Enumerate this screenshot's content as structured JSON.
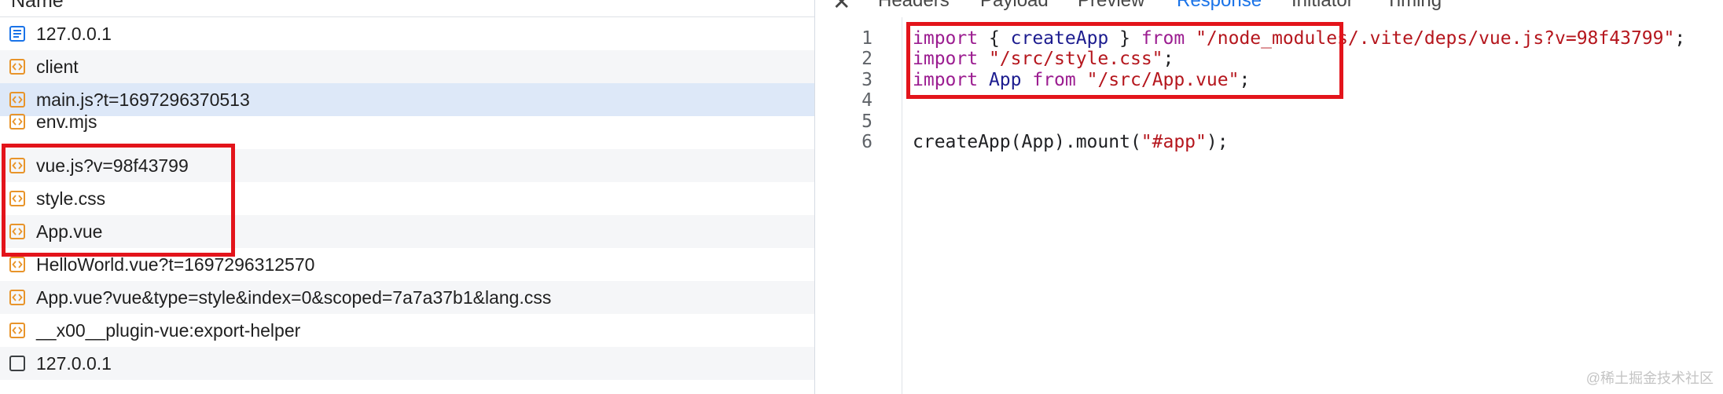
{
  "requests": {
    "header": "Name",
    "items": [
      {
        "label": "127.0.0.1",
        "icon": "document-icon"
      },
      {
        "label": "client",
        "icon": "script-icon"
      },
      {
        "label": "main.js?t=1697296370513",
        "icon": "script-icon"
      },
      {
        "label": "env.mjs",
        "icon": "script-icon"
      },
      {
        "label": "vue.js?v=98f43799",
        "icon": "script-icon"
      },
      {
        "label": "style.css",
        "icon": "script-icon"
      },
      {
        "label": "App.vue",
        "icon": "script-icon"
      },
      {
        "label": "HelloWorld.vue?t=1697296312570",
        "icon": "script-icon"
      },
      {
        "label": "App.vue?vue&type=style&index=0&scoped=7a7a37b1&lang.css",
        "icon": "script-icon"
      },
      {
        "label": "__x00__plugin-vue:export-helper",
        "icon": "script-icon"
      },
      {
        "label": "127.0.0.1",
        "icon": "empty-checkbox-icon"
      }
    ]
  },
  "tabs": {
    "close": "✕",
    "headers": "Headers",
    "payload": "Payload",
    "preview": "Preview",
    "response": "Response",
    "initiator": "Initiator",
    "timing": "Timing"
  },
  "response": {
    "line_numbers": [
      "1",
      "2",
      "3",
      "4",
      "5",
      "6"
    ],
    "line1": {
      "kw1": "import",
      "p1": " { ",
      "id": "createApp",
      "p2": " } ",
      "kw2": "from",
      "sp": " ",
      "str": "\"/node_modules/.vite/deps/vue.js?v=98f43799\"",
      "end": ";"
    },
    "line2": {
      "kw": "import",
      "sp": " ",
      "str": "\"/src/style.css\"",
      "end": ";"
    },
    "line3": {
      "kw1": "import",
      "sp1": " ",
      "id": "App",
      "sp2": " ",
      "kw2": "from",
      "sp3": " ",
      "str": "\"/src/App.vue\"",
      "end": ";"
    },
    "line5": {
      "pre": "createApp(App).mount(",
      "str": "\"#app\"",
      "end": ");"
    }
  },
  "colors": {
    "annotation": "#e3141b",
    "selected_row": "#dde8f8",
    "active_tab": "#1a73e8",
    "keyword": "#9b1c90",
    "string": "#b5161d"
  },
  "watermark": "@稀土掘金技术社区"
}
